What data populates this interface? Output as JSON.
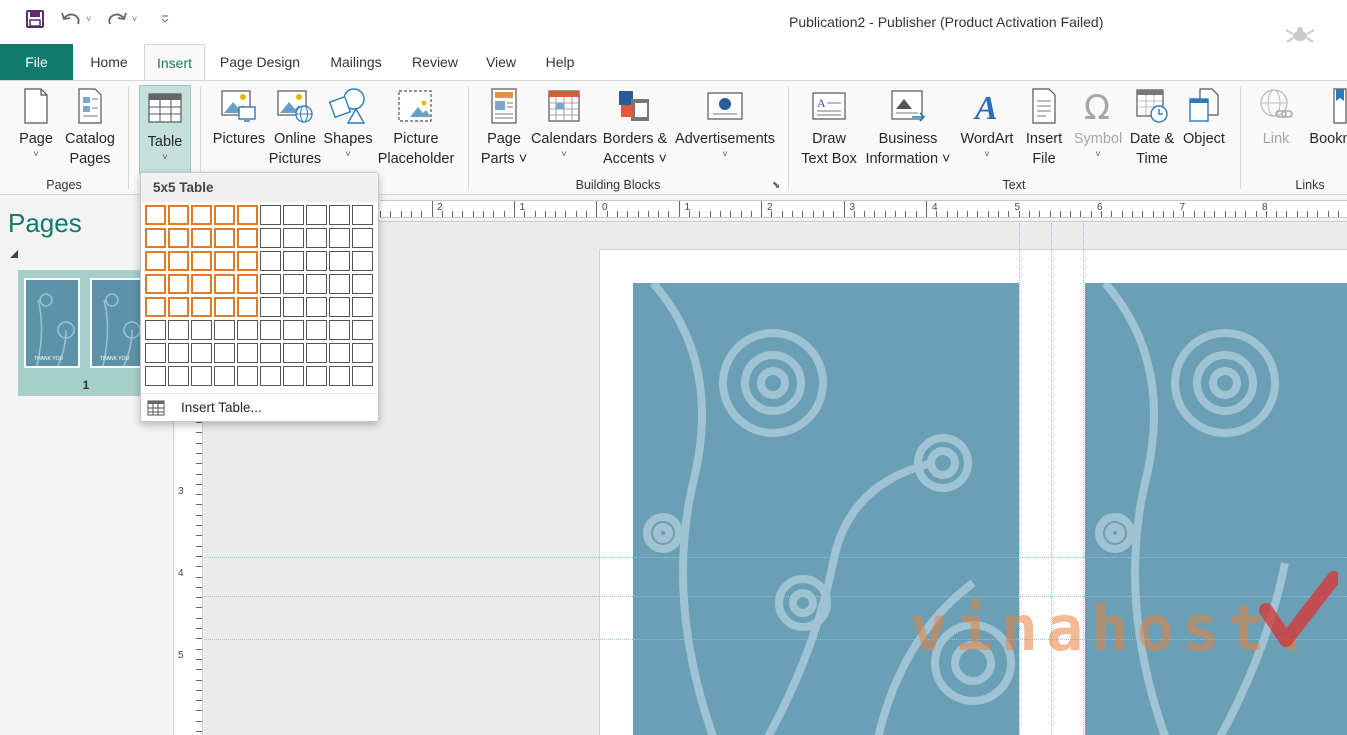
{
  "window": {
    "title": "Publication2  -  Publisher (Product Activation Failed)"
  },
  "qat": {
    "save_icon": "save-icon",
    "undo_icon": "undo-icon",
    "redo_icon": "redo-icon",
    "customize_icon": "customize-qat-icon"
  },
  "tabs": [
    {
      "label": "File"
    },
    {
      "label": "Home"
    },
    {
      "label": "Insert"
    },
    {
      "label": "Page Design"
    },
    {
      "label": "Mailings"
    },
    {
      "label": "Review"
    },
    {
      "label": "View"
    },
    {
      "label": "Help"
    }
  ],
  "ribbon": {
    "page": {
      "line1": "Page",
      "chev": "˅"
    },
    "catalog_pages": {
      "line1": "Catalog",
      "line2": "Pages"
    },
    "group_pages": "Pages",
    "table": {
      "line1": "Table",
      "chev": "˅"
    },
    "pictures": {
      "line1": "Pictures"
    },
    "online_pictures": {
      "line1": "Online",
      "line2": "Pictures"
    },
    "shapes": {
      "line1": "Shapes",
      "chev": "˅"
    },
    "picture_placeholder": {
      "line1": "Picture",
      "line2": "Placeholder"
    },
    "page_parts": {
      "line1": "Page",
      "line2": "Parts ˅"
    },
    "calendars": {
      "line1": "Calendars",
      "chev": "˅"
    },
    "borders_accents": {
      "line1": "Borders &",
      "line2": "Accents ˅"
    },
    "advertisements": {
      "line1": "Advertisements",
      "chev": "˅"
    },
    "group_building_blocks": "Building Blocks",
    "draw_text_box": {
      "line1": "Draw",
      "line2": "Text Box"
    },
    "business_information": {
      "line1": "Business",
      "line2": "Information ˅"
    },
    "wordart": {
      "line1": "WordArt",
      "chev": "˅"
    },
    "insert_file": {
      "line1": "Insert",
      "line2": "File"
    },
    "symbol": {
      "line1": "Symbol",
      "chev": "˅"
    },
    "date_time": {
      "line1": "Date &",
      "line2": "Time"
    },
    "object": {
      "line1": "Object"
    },
    "group_text": "Text",
    "link": {
      "line1": "Link"
    },
    "bookmark": {
      "line1": "Bookm"
    },
    "group_links": "Links",
    "launcher_glyph": "⬊"
  },
  "pages_pane": {
    "title": "Pages",
    "thumbnails": [
      {
        "number": "1"
      }
    ]
  },
  "hruler": {
    "labels": [
      "2",
      "1",
      "0",
      "1",
      "2",
      "3",
      "4",
      "5",
      "6",
      "7",
      "8",
      "9"
    ]
  },
  "vruler": {
    "labels": [
      "2",
      "3",
      "4",
      "5"
    ]
  },
  "table_dropdown": {
    "title": "5x5 Table",
    "rows": 8,
    "cols": 10,
    "selected_rows": 5,
    "selected_cols": 5,
    "insert_table_label": "Insert Table..."
  },
  "watermark": {
    "text": "vinahost."
  },
  "colors": {
    "accent": "#0f7b6c",
    "grid_highlight": "#e07b23",
    "panel_blue": "#6b9fb5"
  }
}
